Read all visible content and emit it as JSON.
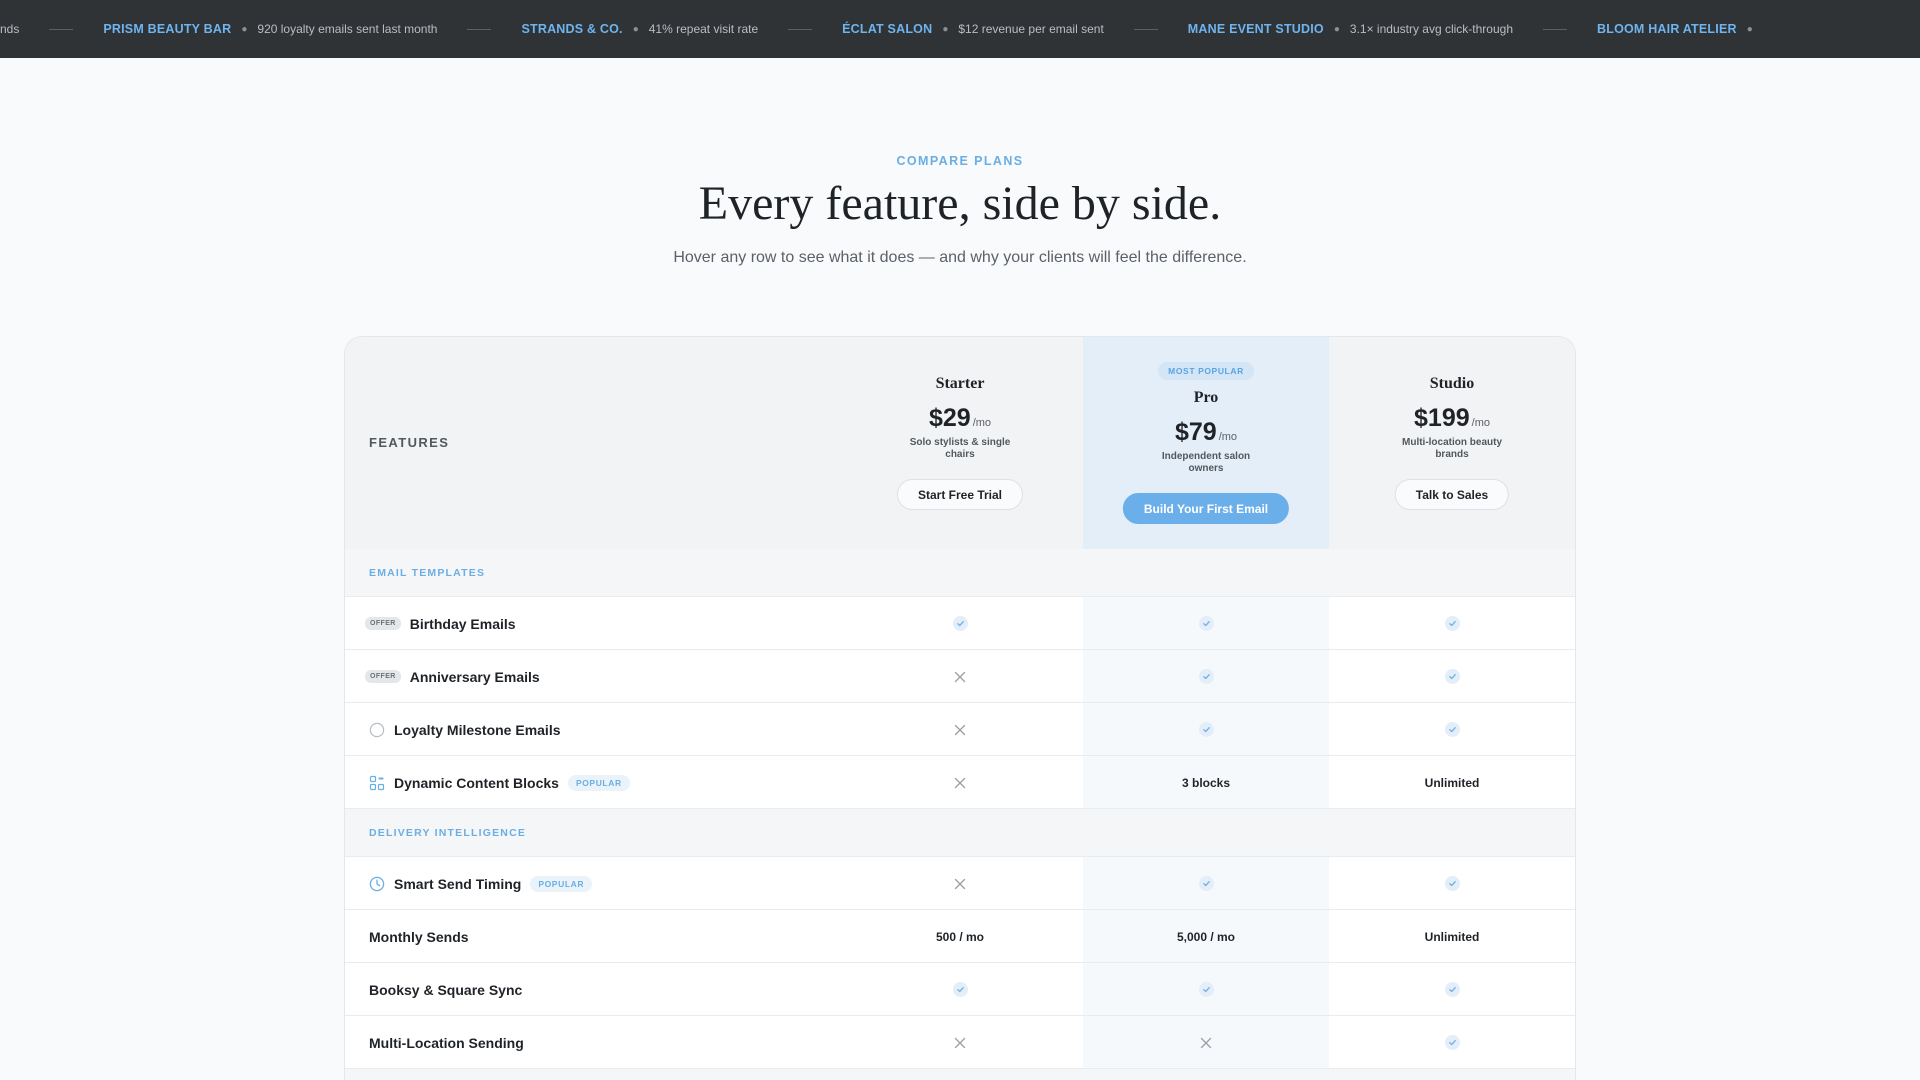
{
  "ticker": {
    "lead_fragment": "nds",
    "items": [
      {
        "name": "PRISM BEAUTY BAR",
        "stat": "920 loyalty emails sent last month"
      },
      {
        "name": "STRANDS & CO.",
        "stat": "41% repeat visit rate"
      },
      {
        "name": "ÉCLAT SALON",
        "stat": "$12 revenue per email sent"
      },
      {
        "name": "MANE EVENT STUDIO",
        "stat": "3.1× industry avg click-through"
      },
      {
        "name": "BLOOM HAIR ATELIER",
        "stat": ""
      }
    ]
  },
  "hero": {
    "eyebrow": "COMPARE PLANS",
    "title": "Every feature, side by side.",
    "subtitle": "Hover any row to see what it does — and why your clients will feel the difference."
  },
  "table": {
    "features_label": "FEATURES",
    "plans": [
      {
        "key": "starter",
        "name": "Starter",
        "price": "$29",
        "per": "/mo",
        "desc": "Solo stylists & single chairs",
        "cta": "Start Free Trial",
        "badge": ""
      },
      {
        "key": "pro",
        "name": "Pro",
        "price": "$79",
        "per": "/mo",
        "desc": "Independent salon owners",
        "cta": "Build Your First Email",
        "badge": "MOST POPULAR"
      },
      {
        "key": "studio",
        "name": "Studio",
        "price": "$199",
        "per": "/mo",
        "desc": "Multi-location beauty brands",
        "cta": "Talk to Sales",
        "badge": ""
      }
    ],
    "sections": [
      {
        "label": "EMAIL TEMPLATES",
        "rows": [
          {
            "name": "Birthday Emails",
            "prefix": "OFFER",
            "icon": "offer-tag",
            "tag": "",
            "values": [
              "check",
              "check",
              "check"
            ]
          },
          {
            "name": "Anniversary Emails",
            "prefix": "OFFER",
            "icon": "offer-tag",
            "tag": "",
            "values": [
              "cross",
              "check",
              "check"
            ]
          },
          {
            "name": "Loyalty Milestone Emails",
            "prefix": "",
            "icon": "circle-icon",
            "tag": "",
            "values": [
              "cross",
              "check",
              "check"
            ]
          },
          {
            "name": "Dynamic Content Blocks",
            "prefix": "",
            "icon": "blocks-icon",
            "tag": "POPULAR",
            "values": [
              "cross",
              "3 blocks",
              "Unlimited"
            ]
          }
        ]
      },
      {
        "label": "DELIVERY INTELLIGENCE",
        "rows": [
          {
            "name": "Smart Send Timing",
            "prefix": "",
            "icon": "clock-icon",
            "tag": "POPULAR",
            "values": [
              "cross",
              "check",
              "check"
            ]
          },
          {
            "name": "Monthly Sends",
            "prefix": "",
            "icon": "",
            "tag": "",
            "values": [
              "500 / mo",
              "5,000 / mo",
              "Unlimited"
            ]
          },
          {
            "name": "Booksy & Square Sync",
            "prefix": "",
            "icon": "",
            "tag": "",
            "values": [
              "check",
              "check",
              "check"
            ]
          },
          {
            "name": "Multi-Location Sending",
            "prefix": "",
            "icon": "",
            "tag": "",
            "values": [
              "cross",
              "cross",
              "check"
            ]
          }
        ]
      }
    ]
  },
  "colors": {
    "accent": "#6aaeea",
    "ticker_bg": "#2f3336",
    "check_bg": "#e3eef9",
    "check_mark": "#6aaee4",
    "cross": "#9aa0a6"
  }
}
